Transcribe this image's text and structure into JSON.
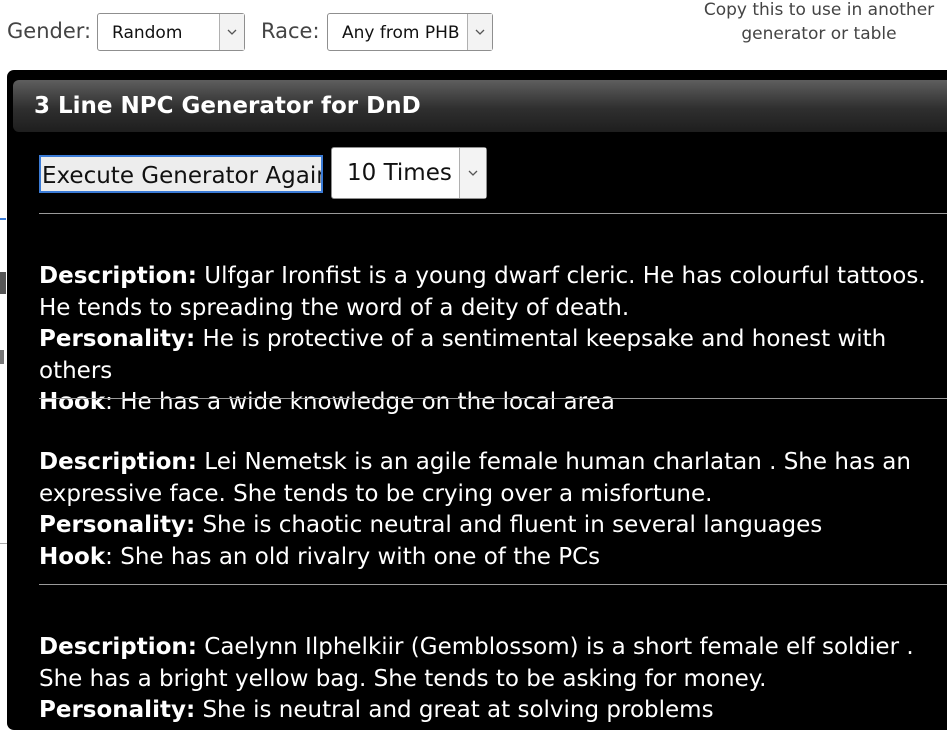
{
  "form": {
    "gender_label": "Gender:",
    "gender_value": "Random",
    "race_label": "Race:",
    "race_value": "Any from PHB",
    "copy_note": "Copy this to use in another generator or table"
  },
  "panel": {
    "title": "3 Line NPC Generator for DnD",
    "execute_label": "Execute Generator Again",
    "times_value": "10 Times"
  },
  "labels": {
    "description": "Description:",
    "personality": "Personality:",
    "hook": "Hook"
  },
  "npcs": [
    {
      "description": " Ulfgar Ironfist is a young dwarf cleric. He has colourful tattoos. He tends to spreading the word of a deity of death.",
      "personality": " He is protective of a sentimental keepsake and honest with others",
      "hook": ": He has a wide knowledge on the local area"
    },
    {
      "description": " Lei Nemetsk is an agile female human charlatan . She has an expressive face. She tends to be crying over a misfortune.",
      "personality": " She is chaotic neutral and fluent in several languages",
      "hook": ": She has an old rivalry with one of the PCs"
    },
    {
      "description": " Caelynn Ilphelkiir (Gemblossom) is a short female elf soldier . She has a bright yellow bag. She tends to be asking for money.",
      "personality": " She is neutral and great at solving problems",
      "hook": ""
    }
  ],
  "colors": {
    "panel_bg": "#000000",
    "button_focus": "#3b7bd6"
  }
}
